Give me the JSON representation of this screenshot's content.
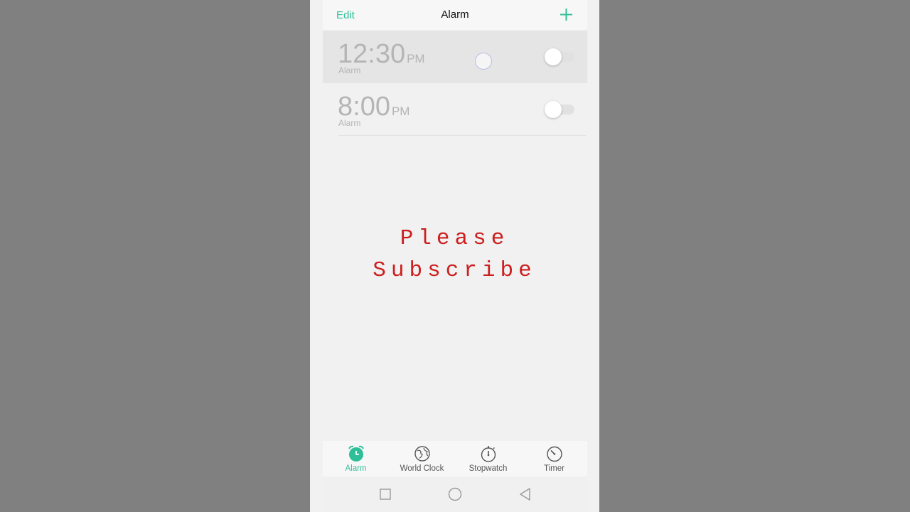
{
  "header": {
    "edit_label": "Edit",
    "title": "Alarm",
    "add_icon": "plus-icon"
  },
  "alarms": [
    {
      "time": "12:30",
      "ampm": "PM",
      "label": "Alarm",
      "enabled": false,
      "selected": true
    },
    {
      "time": "8:00",
      "ampm": "PM",
      "label": "Alarm",
      "enabled": false,
      "selected": false
    }
  ],
  "overlay": {
    "line1": "Please",
    "line2": "Subscribe"
  },
  "tabs": [
    {
      "label": "Alarm",
      "icon": "alarm-clock-icon",
      "active": true
    },
    {
      "label": "World Clock",
      "icon": "globe-icon",
      "active": false
    },
    {
      "label": "Stopwatch",
      "icon": "stopwatch-icon",
      "active": false
    },
    {
      "label": "Timer",
      "icon": "timer-icon",
      "active": false
    }
  ],
  "system_nav": {
    "recents_icon": "square-icon",
    "home_icon": "circle-icon",
    "back_icon": "triangle-back-icon"
  },
  "colors": {
    "accent": "#2fbf98",
    "overlay_text": "#cc1f1f",
    "backdrop": "#808080"
  }
}
